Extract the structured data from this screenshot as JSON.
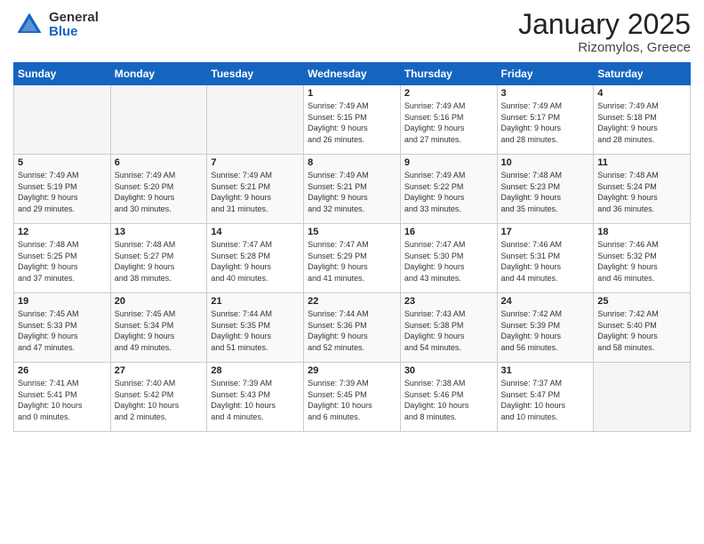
{
  "logo": {
    "general": "General",
    "blue": "Blue"
  },
  "title": "January 2025",
  "location": "Rizomylos, Greece",
  "days_header": [
    "Sunday",
    "Monday",
    "Tuesday",
    "Wednesday",
    "Thursday",
    "Friday",
    "Saturday"
  ],
  "weeks": [
    [
      {
        "day": "",
        "info": ""
      },
      {
        "day": "",
        "info": ""
      },
      {
        "day": "",
        "info": ""
      },
      {
        "day": "1",
        "info": "Sunrise: 7:49 AM\nSunset: 5:15 PM\nDaylight: 9 hours\nand 26 minutes."
      },
      {
        "day": "2",
        "info": "Sunrise: 7:49 AM\nSunset: 5:16 PM\nDaylight: 9 hours\nand 27 minutes."
      },
      {
        "day": "3",
        "info": "Sunrise: 7:49 AM\nSunset: 5:17 PM\nDaylight: 9 hours\nand 28 minutes."
      },
      {
        "day": "4",
        "info": "Sunrise: 7:49 AM\nSunset: 5:18 PM\nDaylight: 9 hours\nand 28 minutes."
      }
    ],
    [
      {
        "day": "5",
        "info": "Sunrise: 7:49 AM\nSunset: 5:19 PM\nDaylight: 9 hours\nand 29 minutes."
      },
      {
        "day": "6",
        "info": "Sunrise: 7:49 AM\nSunset: 5:20 PM\nDaylight: 9 hours\nand 30 minutes."
      },
      {
        "day": "7",
        "info": "Sunrise: 7:49 AM\nSunset: 5:21 PM\nDaylight: 9 hours\nand 31 minutes."
      },
      {
        "day": "8",
        "info": "Sunrise: 7:49 AM\nSunset: 5:21 PM\nDaylight: 9 hours\nand 32 minutes."
      },
      {
        "day": "9",
        "info": "Sunrise: 7:49 AM\nSunset: 5:22 PM\nDaylight: 9 hours\nand 33 minutes."
      },
      {
        "day": "10",
        "info": "Sunrise: 7:48 AM\nSunset: 5:23 PM\nDaylight: 9 hours\nand 35 minutes."
      },
      {
        "day": "11",
        "info": "Sunrise: 7:48 AM\nSunset: 5:24 PM\nDaylight: 9 hours\nand 36 minutes."
      }
    ],
    [
      {
        "day": "12",
        "info": "Sunrise: 7:48 AM\nSunset: 5:25 PM\nDaylight: 9 hours\nand 37 minutes."
      },
      {
        "day": "13",
        "info": "Sunrise: 7:48 AM\nSunset: 5:27 PM\nDaylight: 9 hours\nand 38 minutes."
      },
      {
        "day": "14",
        "info": "Sunrise: 7:47 AM\nSunset: 5:28 PM\nDaylight: 9 hours\nand 40 minutes."
      },
      {
        "day": "15",
        "info": "Sunrise: 7:47 AM\nSunset: 5:29 PM\nDaylight: 9 hours\nand 41 minutes."
      },
      {
        "day": "16",
        "info": "Sunrise: 7:47 AM\nSunset: 5:30 PM\nDaylight: 9 hours\nand 43 minutes."
      },
      {
        "day": "17",
        "info": "Sunrise: 7:46 AM\nSunset: 5:31 PM\nDaylight: 9 hours\nand 44 minutes."
      },
      {
        "day": "18",
        "info": "Sunrise: 7:46 AM\nSunset: 5:32 PM\nDaylight: 9 hours\nand 46 minutes."
      }
    ],
    [
      {
        "day": "19",
        "info": "Sunrise: 7:45 AM\nSunset: 5:33 PM\nDaylight: 9 hours\nand 47 minutes."
      },
      {
        "day": "20",
        "info": "Sunrise: 7:45 AM\nSunset: 5:34 PM\nDaylight: 9 hours\nand 49 minutes."
      },
      {
        "day": "21",
        "info": "Sunrise: 7:44 AM\nSunset: 5:35 PM\nDaylight: 9 hours\nand 51 minutes."
      },
      {
        "day": "22",
        "info": "Sunrise: 7:44 AM\nSunset: 5:36 PM\nDaylight: 9 hours\nand 52 minutes."
      },
      {
        "day": "23",
        "info": "Sunrise: 7:43 AM\nSunset: 5:38 PM\nDaylight: 9 hours\nand 54 minutes."
      },
      {
        "day": "24",
        "info": "Sunrise: 7:42 AM\nSunset: 5:39 PM\nDaylight: 9 hours\nand 56 minutes."
      },
      {
        "day": "25",
        "info": "Sunrise: 7:42 AM\nSunset: 5:40 PM\nDaylight: 9 hours\nand 58 minutes."
      }
    ],
    [
      {
        "day": "26",
        "info": "Sunrise: 7:41 AM\nSunset: 5:41 PM\nDaylight: 10 hours\nand 0 minutes."
      },
      {
        "day": "27",
        "info": "Sunrise: 7:40 AM\nSunset: 5:42 PM\nDaylight: 10 hours\nand 2 minutes."
      },
      {
        "day": "28",
        "info": "Sunrise: 7:39 AM\nSunset: 5:43 PM\nDaylight: 10 hours\nand 4 minutes."
      },
      {
        "day": "29",
        "info": "Sunrise: 7:39 AM\nSunset: 5:45 PM\nDaylight: 10 hours\nand 6 minutes."
      },
      {
        "day": "30",
        "info": "Sunrise: 7:38 AM\nSunset: 5:46 PM\nDaylight: 10 hours\nand 8 minutes."
      },
      {
        "day": "31",
        "info": "Sunrise: 7:37 AM\nSunset: 5:47 PM\nDaylight: 10 hours\nand 10 minutes."
      },
      {
        "day": "",
        "info": ""
      }
    ]
  ]
}
